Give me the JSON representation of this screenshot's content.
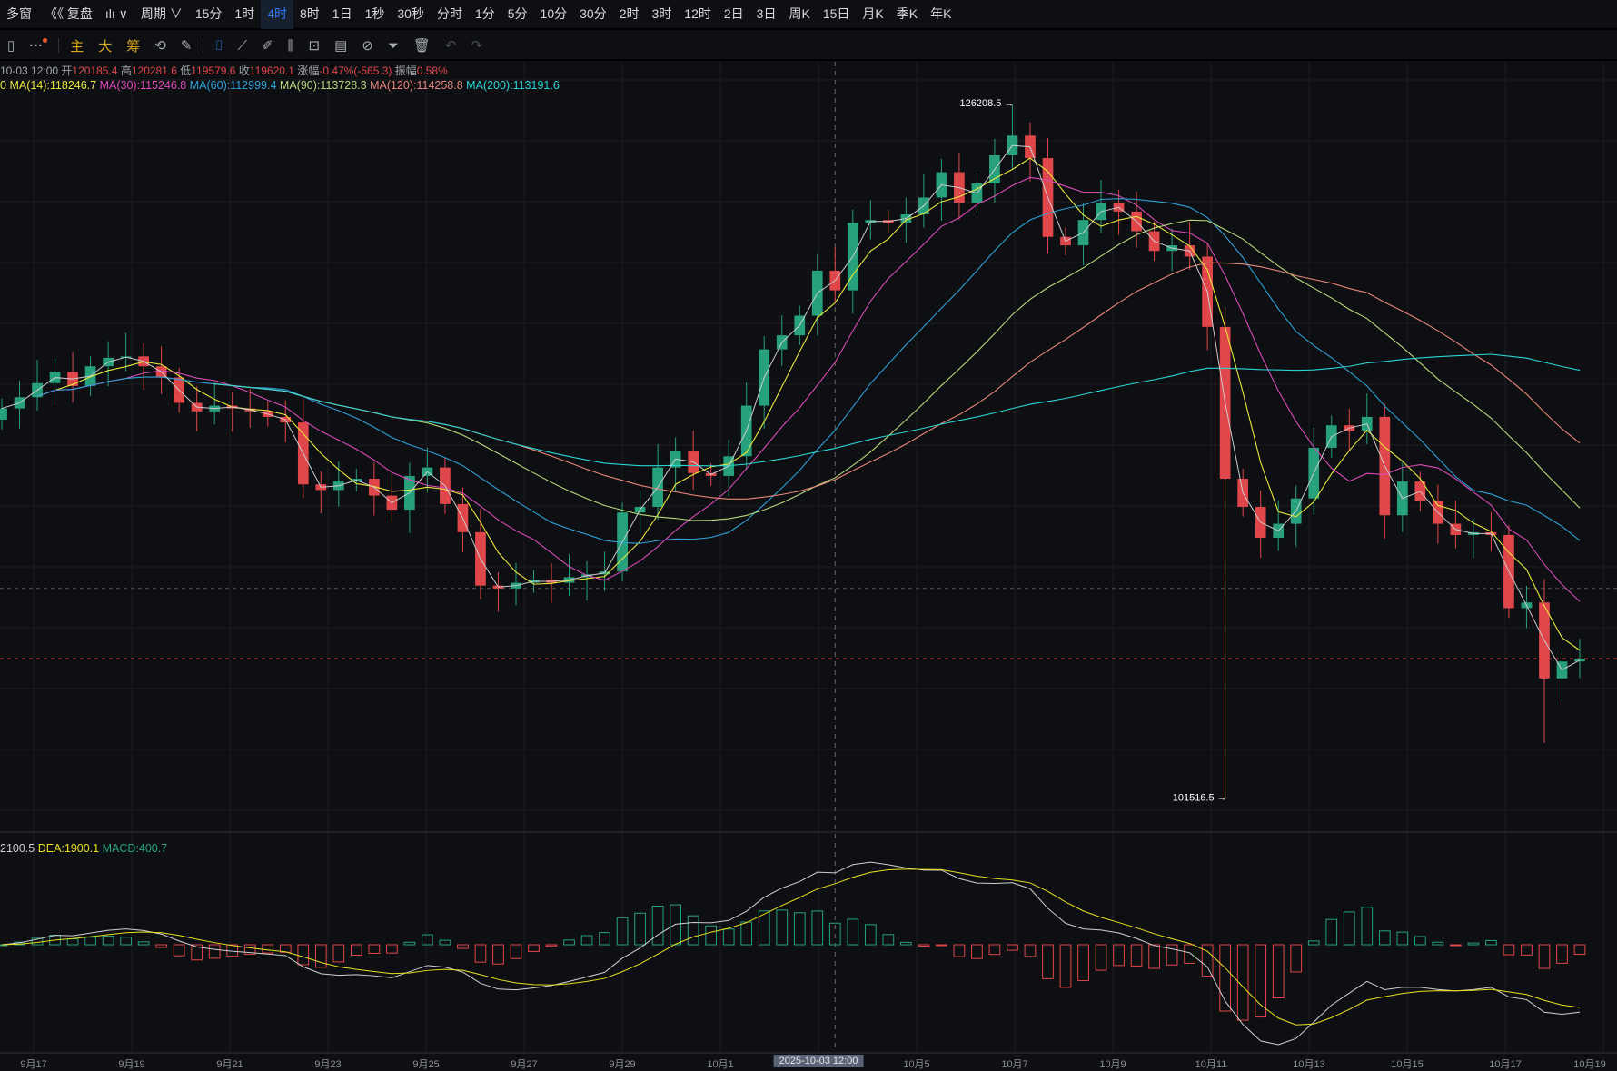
{
  "topbar": {
    "items": [
      "多窗",
      "《《 复盘",
      "ılı ∨",
      "周期 ∨",
      "15分",
      "1时",
      "4时",
      "8时",
      "1日",
      "1秒",
      "30秒",
      "分时",
      "1分",
      "5分",
      "10分",
      "30分",
      "2时",
      "3时",
      "12时",
      "2日",
      "3日",
      "周K",
      "15日",
      "月K",
      "季K",
      "年K"
    ],
    "active": "4时"
  },
  "toolbar": {
    "more": "···",
    "main": "主",
    "big": "大",
    "chips": "筹",
    "icons": [
      "cycle-icon",
      "brush-icon",
      "bookmark-icon",
      "ruler-icon",
      "pen-icon",
      "candles-icon",
      "lock-icon",
      "note-icon",
      "magnet-icon",
      "filter-icon",
      "trash-icon",
      "undo-icon",
      "redo-icon"
    ]
  },
  "info": {
    "date": "10-03 12:00",
    "open_label": "开",
    "open": "120185.4",
    "high_label": "高",
    "high": "120281.6",
    "low_label": "低",
    "low": "119579.6",
    "close_label": "收",
    "close": "119620.1",
    "change_label": "涨幅",
    "change": "-0.47%(-565.3)",
    "amp_label": "振幅",
    "amp": "0.58%"
  },
  "ma": {
    "lead": "0",
    "ma14": "MA(14):118246.7",
    "ma30": "MA(30):115246.8",
    "ma60": "MA(60):112999.4",
    "ma90": "MA(90):113728.3",
    "ma120": "MA(120):114258.8",
    "ma200": "MA(200):113191.6"
  },
  "macd": {
    "dif": "2100.5",
    "dea": "DEA:1900.1",
    "macd": "MACD:400.7"
  },
  "colors": {
    "up": "#26a17b",
    "down": "#e0474a",
    "ma14": "#e8e83c",
    "ma30": "#d94bb8",
    "ma60": "#2fa0d8",
    "ma90": "#b8d87a",
    "ma120": "#e8857a",
    "ma200": "#2bd4d4",
    "dif": "#d0d0d0",
    "dea": "#e8e020"
  },
  "xaxis": [
    "9月17",
    "9月19",
    "9月21",
    "9月23",
    "9月25",
    "9月27",
    "9月29",
    "10月1",
    "2025-10-03 12:00",
    "10月5",
    "10月7",
    "10月9",
    "10月11",
    "10月13",
    "10月15",
    "10月17",
    "10月19"
  ],
  "chart_data": {
    "type": "candlestick",
    "interval": "4h",
    "closes": [
      115400,
      115800,
      116300,
      116700,
      116200,
      116900,
      117200,
      117250,
      116900,
      116500,
      115600,
      115300,
      115500,
      115400,
      115300,
      115100,
      114900,
      112700,
      112500,
      112800,
      112900,
      112300,
      111800,
      113000,
      113300,
      112000,
      111000,
      109100,
      109000,
      109200,
      109300,
      109200,
      109400,
      109500,
      109600,
      111700,
      111900,
      113300,
      113900,
      113100,
      113000,
      113700,
      115500,
      117500,
      118000,
      118700,
      120300,
      119600,
      122000,
      122100,
      122000,
      122300,
      122900,
      123800,
      122700,
      123400,
      124400,
      125100,
      124300,
      121500,
      121200,
      122100,
      122700,
      122400,
      121700,
      121000,
      121200,
      120800,
      118300,
      112900,
      111900,
      110800,
      111300,
      112200,
      114000,
      114800,
      114600,
      115100,
      111600,
      112800,
      112100,
      111300,
      110900,
      111000,
      110900,
      108300,
      108500,
      105800,
      106400,
      106500
    ],
    "first_open": 115000,
    "high_marker": {
      "index": 57,
      "value": "126208.5"
    },
    "low_marker": {
      "index": 69,
      "value": "101516.5"
    },
    "ylim": [
      100500,
      128500
    ],
    "price_lines": [
      109000,
      106500
    ],
    "crosshair_index": 47
  }
}
